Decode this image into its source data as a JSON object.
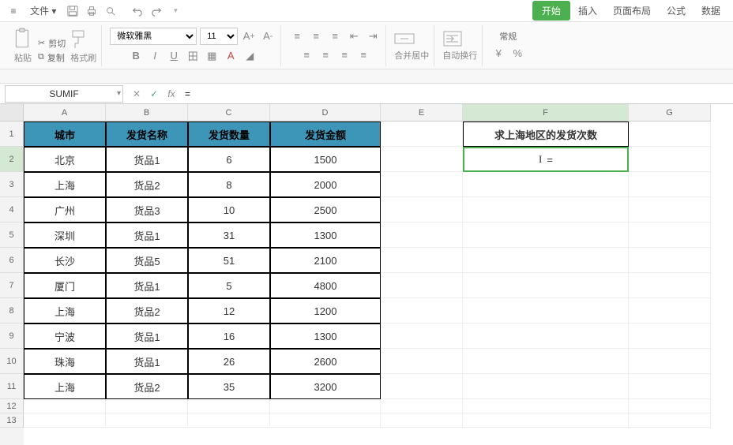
{
  "menu": {
    "file": "文件",
    "dropdown_icon": "▾"
  },
  "tabs": {
    "start": "开始",
    "insert": "插入",
    "layout": "页面布局",
    "formula": "公式",
    "data": "数据"
  },
  "ribbon": {
    "paste": "粘贴",
    "cut": "剪切",
    "copy": "复制",
    "format_painter": "格式刷",
    "font_name": "微软雅黑",
    "font_size": "11",
    "merge_center": "合并居中",
    "wrap_text": "自动换行",
    "general": "常规"
  },
  "formula_bar": {
    "name_box": "SUMIF",
    "formula": "="
  },
  "columns": [
    "A",
    "B",
    "C",
    "D",
    "E",
    "F",
    "G"
  ],
  "row_numbers": [
    "1",
    "2",
    "3",
    "4",
    "5",
    "6",
    "7",
    "8",
    "9",
    "10",
    "11",
    "12",
    "13"
  ],
  "headers": {
    "city": "城市",
    "product": "发货名称",
    "qty": "发货数量",
    "amount": "发货金额"
  },
  "rows": [
    {
      "city": "北京",
      "product": "货品1",
      "qty": "6",
      "amount": "1500"
    },
    {
      "city": "上海",
      "product": "货品2",
      "qty": "8",
      "amount": "2000"
    },
    {
      "city": "广州",
      "product": "货品3",
      "qty": "10",
      "amount": "2500"
    },
    {
      "city": "深圳",
      "product": "货品1",
      "qty": "31",
      "amount": "1300"
    },
    {
      "city": "长沙",
      "product": "货品5",
      "qty": "51",
      "amount": "2100"
    },
    {
      "city": "厦门",
      "product": "货品1",
      "qty": "5",
      "amount": "4800"
    },
    {
      "city": "上海",
      "product": "货品2",
      "qty": "12",
      "amount": "1200"
    },
    {
      "city": "宁波",
      "product": "货品1",
      "qty": "16",
      "amount": "1300"
    },
    {
      "city": "珠海",
      "product": "货品1",
      "qty": "26",
      "amount": "2600"
    },
    {
      "city": "上海",
      "product": "货品2",
      "qty": "35",
      "amount": "3200"
    }
  ],
  "side": {
    "title": "求上海地区的发货次数",
    "editing_value": "="
  }
}
